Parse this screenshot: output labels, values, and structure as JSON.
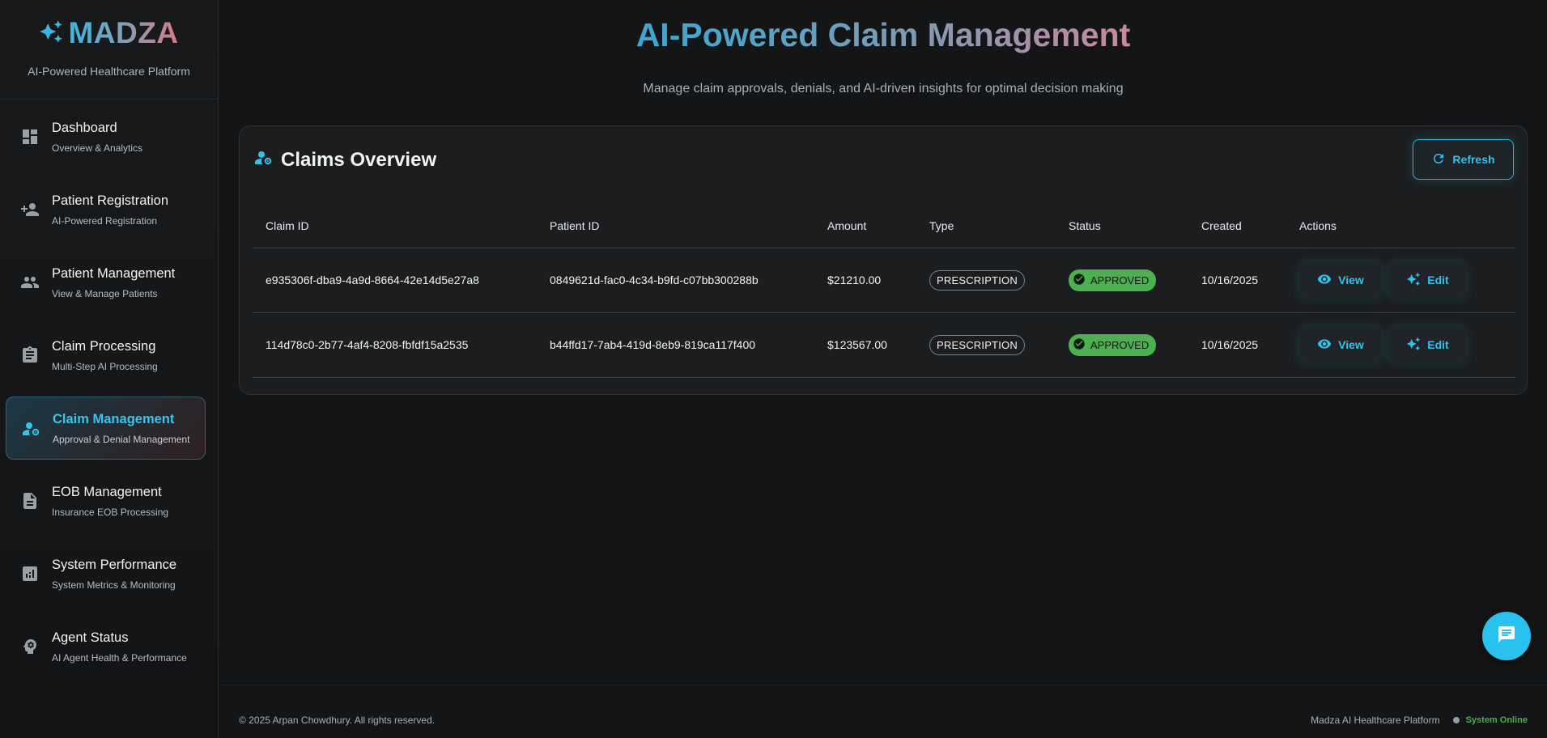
{
  "brand": {
    "name": "MADZA",
    "tagline": "AI-Powered Healthcare Platform"
  },
  "sidebar": {
    "items": [
      {
        "label": "Dashboard",
        "sub": "Overview & Analytics",
        "icon": "dashboard-icon"
      },
      {
        "label": "Patient Registration",
        "sub": "AI-Powered Registration",
        "icon": "person-add-icon"
      },
      {
        "label": "Patient Management",
        "sub": "View & Manage Patients",
        "icon": "people-icon"
      },
      {
        "label": "Claim Processing",
        "sub": "Multi-Step AI Processing",
        "icon": "clipboard-icon"
      },
      {
        "label": "Claim Management",
        "sub": "Approval & Denial Management",
        "icon": "manage-accounts-icon",
        "active": true
      },
      {
        "label": "EOB Management",
        "sub": "Insurance EOB Processing",
        "icon": "document-icon"
      },
      {
        "label": "System Performance",
        "sub": "System Metrics & Monitoring",
        "icon": "analytics-icon"
      },
      {
        "label": "Agent Status",
        "sub": "AI Agent Health & Performance",
        "icon": "psychology-icon"
      }
    ]
  },
  "header": {
    "title": "AI-Powered Claim Management",
    "subtitle": "Manage claim approvals, denials, and AI-driven insights for optimal decision making"
  },
  "card": {
    "title": "Claims Overview",
    "refresh_label": "Refresh"
  },
  "table": {
    "columns": [
      "Claim ID",
      "Patient ID",
      "Amount",
      "Type",
      "Status",
      "Created",
      "Actions"
    ],
    "rows": [
      {
        "claim_id": "e935306f-dba9-4a9d-8664-42e14d5e27a8",
        "patient_id": "0849621d-fac0-4c34-b9fd-c07bb300288b",
        "amount": "$21210.00",
        "type": "PRESCRIPTION",
        "status": "APPROVED",
        "created": "10/16/2025",
        "view_label": "View",
        "edit_label": "Edit"
      },
      {
        "claim_id": "114d78c0-2b77-4af4-8208-fbfdf15a2535",
        "patient_id": "b44ffd17-7ab4-419d-8eb9-819ca117f400",
        "amount": "$123567.00",
        "type": "PRESCRIPTION",
        "status": "APPROVED",
        "created": "10/16/2025",
        "view_label": "View",
        "edit_label": "Edit"
      }
    ]
  },
  "footer": {
    "copyright": "© 2025 Arpan Chowdhury. All rights reserved.",
    "platform": "Madza AI Healthcare Platform",
    "system_status": "System Online"
  },
  "colors": {
    "accent": "#29c1ee",
    "status_approved": "#4caf50",
    "background": "#141516"
  }
}
